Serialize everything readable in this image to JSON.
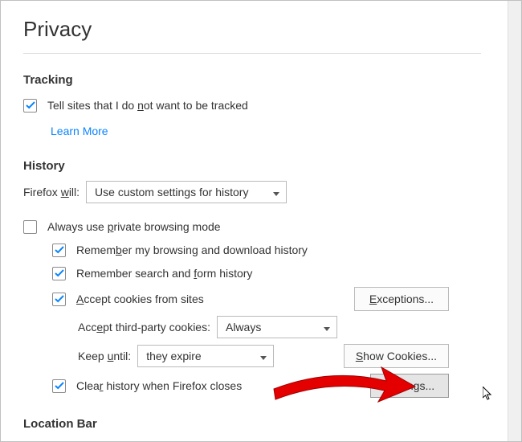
{
  "page": {
    "title": "Privacy"
  },
  "tracking": {
    "heading": "Tracking",
    "doNotTrack_label": "Tell sites that I do not want to be tracked",
    "learnMore": "Learn More"
  },
  "history": {
    "heading": "History",
    "willLabel_pre": "Firefox ",
    "willLabel_u": "w",
    "willLabel_post": "ill:",
    "willSelect": "Use custom settings for history",
    "privateMode_pre": "Always use ",
    "privateMode_u": "p",
    "privateMode_post": "rivate browsing mode",
    "rememberBrowsing_pre": "Remem",
    "rememberBrowsing_u": "b",
    "rememberBrowsing_post": "er my browsing and download history",
    "rememberForms_pre": "Remember search and ",
    "rememberForms_u": "f",
    "rememberForms_post": "orm history",
    "acceptCookies_u": "A",
    "acceptCookies_post": "ccept cookies from sites",
    "exceptionsBtn_u": "E",
    "exceptionsBtn_post": "xceptions...",
    "thirdParty_pre": "Acc",
    "thirdParty_u": "e",
    "thirdParty_post": "pt third-party cookies:",
    "thirdPartySelect": "Always",
    "keepUntil_pre": "Keep ",
    "keepUntil_u": "u",
    "keepUntil_post": "ntil:",
    "keepUntilSelect": "they expire",
    "showCookies_u": "S",
    "showCookies_post": "how Cookies...",
    "clearOnClose_pre": "Clea",
    "clearOnClose_u": "r",
    "clearOnClose_post": " history when Firefox closes",
    "settingsBtn_pre": "Se",
    "settingsBtn_u": "t",
    "settingsBtn_post": "tings..."
  },
  "locationBar": {
    "heading": "Location Bar"
  },
  "colors": {
    "check": "#0a84ff",
    "arrow": "#e40000"
  }
}
